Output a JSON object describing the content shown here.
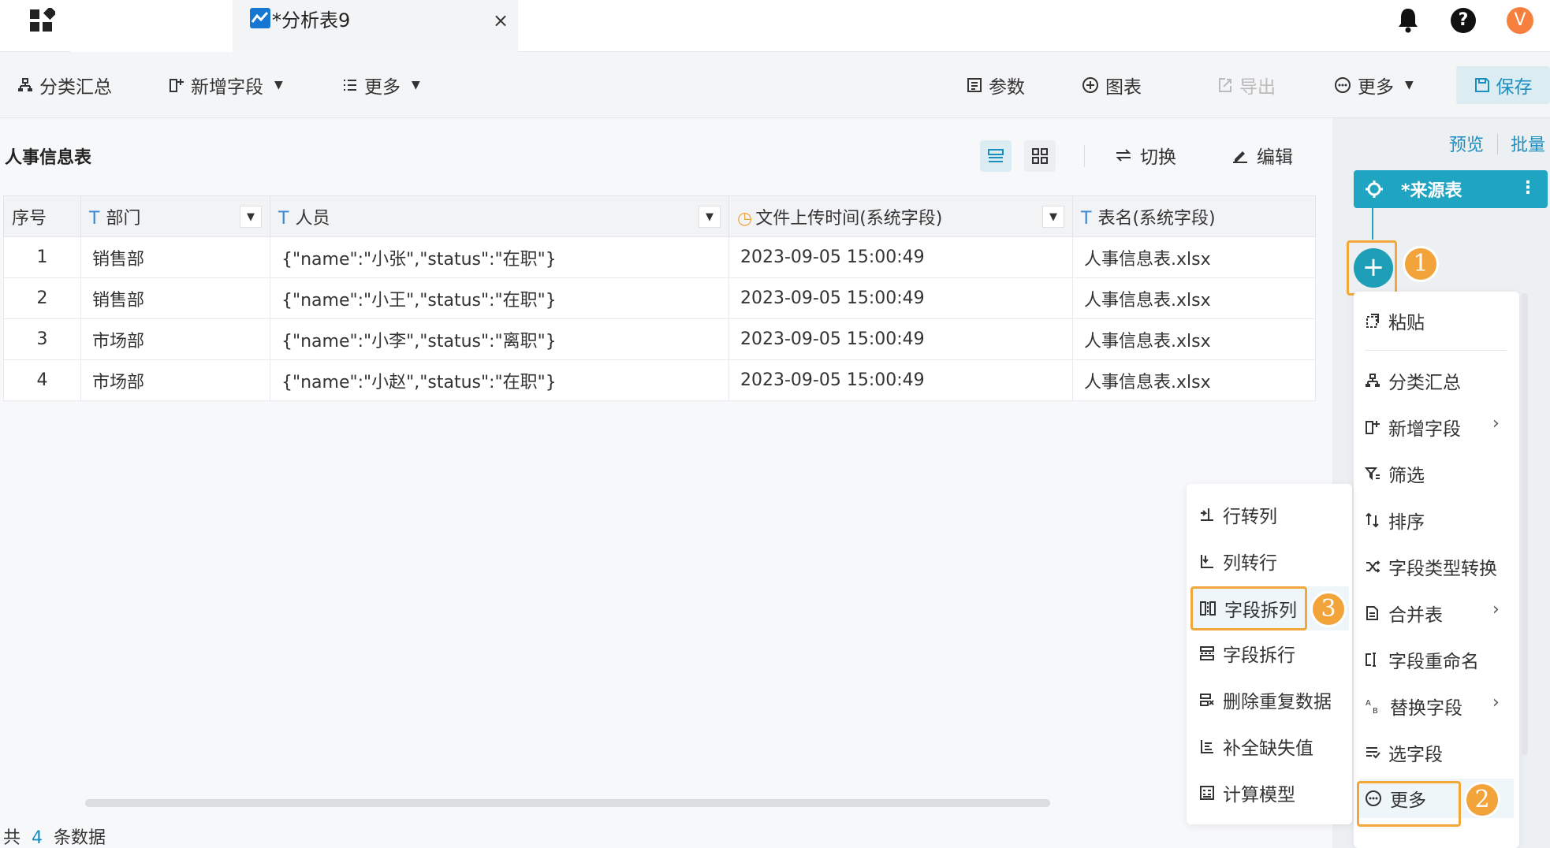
{
  "tab": {
    "title": "*分析表9",
    "close": "×"
  },
  "header": {
    "avatar_letter": "V"
  },
  "toolbar": {
    "group_summary": "分类汇总",
    "add_field": "新增字段",
    "more_left": "更多",
    "params": "参数",
    "chart": "图表",
    "export": "导出",
    "more_right": "更多",
    "save": "保存"
  },
  "table": {
    "title": "人事信息表",
    "switch_label": "切换",
    "edit_label": "编辑",
    "columns": [
      "序号",
      "部门",
      "人员",
      "文件上传时间(系统字段)",
      "表名(系统字段)"
    ],
    "rows": [
      [
        "1",
        "销售部",
        "{\"name\":\"小张\",\"status\":\"在职\"}",
        "2023-09-05 15:00:49",
        "人事信息表.xlsx"
      ],
      [
        "2",
        "销售部",
        "{\"name\":\"小王\",\"status\":\"在职\"}",
        "2023-09-05 15:00:49",
        "人事信息表.xlsx"
      ],
      [
        "3",
        "市场部",
        "{\"name\":\"小李\",\"status\":\"离职\"}",
        "2023-09-05 15:00:49",
        "人事信息表.xlsx"
      ],
      [
        "4",
        "市场部",
        "{\"name\":\"小赵\",\"status\":\"在职\"}",
        "2023-09-05 15:00:49",
        "人事信息表.xlsx"
      ]
    ],
    "footer": {
      "prefix": "共",
      "count": "4",
      "suffix": "条数据"
    }
  },
  "right_panel": {
    "preview": "预览",
    "batch": "批量",
    "source_node": "*来源表",
    "plus": "+",
    "menu_items": [
      "粘贴",
      "分类汇总",
      "新增字段",
      "筛选",
      "排序",
      "字段类型转换",
      "合并表",
      "字段重命名",
      "替换字段",
      "选字段",
      "更多"
    ],
    "submenu_items": [
      "行转列",
      "列转行",
      "字段拆列",
      "字段拆行",
      "删除重复数据",
      "补全缺失值",
      "计算模型"
    ]
  },
  "badges": [
    "1",
    "2",
    "3"
  ],
  "colors": {
    "accent": "#1fa4c2",
    "highlight": "#f2a73a",
    "link": "#1a8fbf"
  }
}
